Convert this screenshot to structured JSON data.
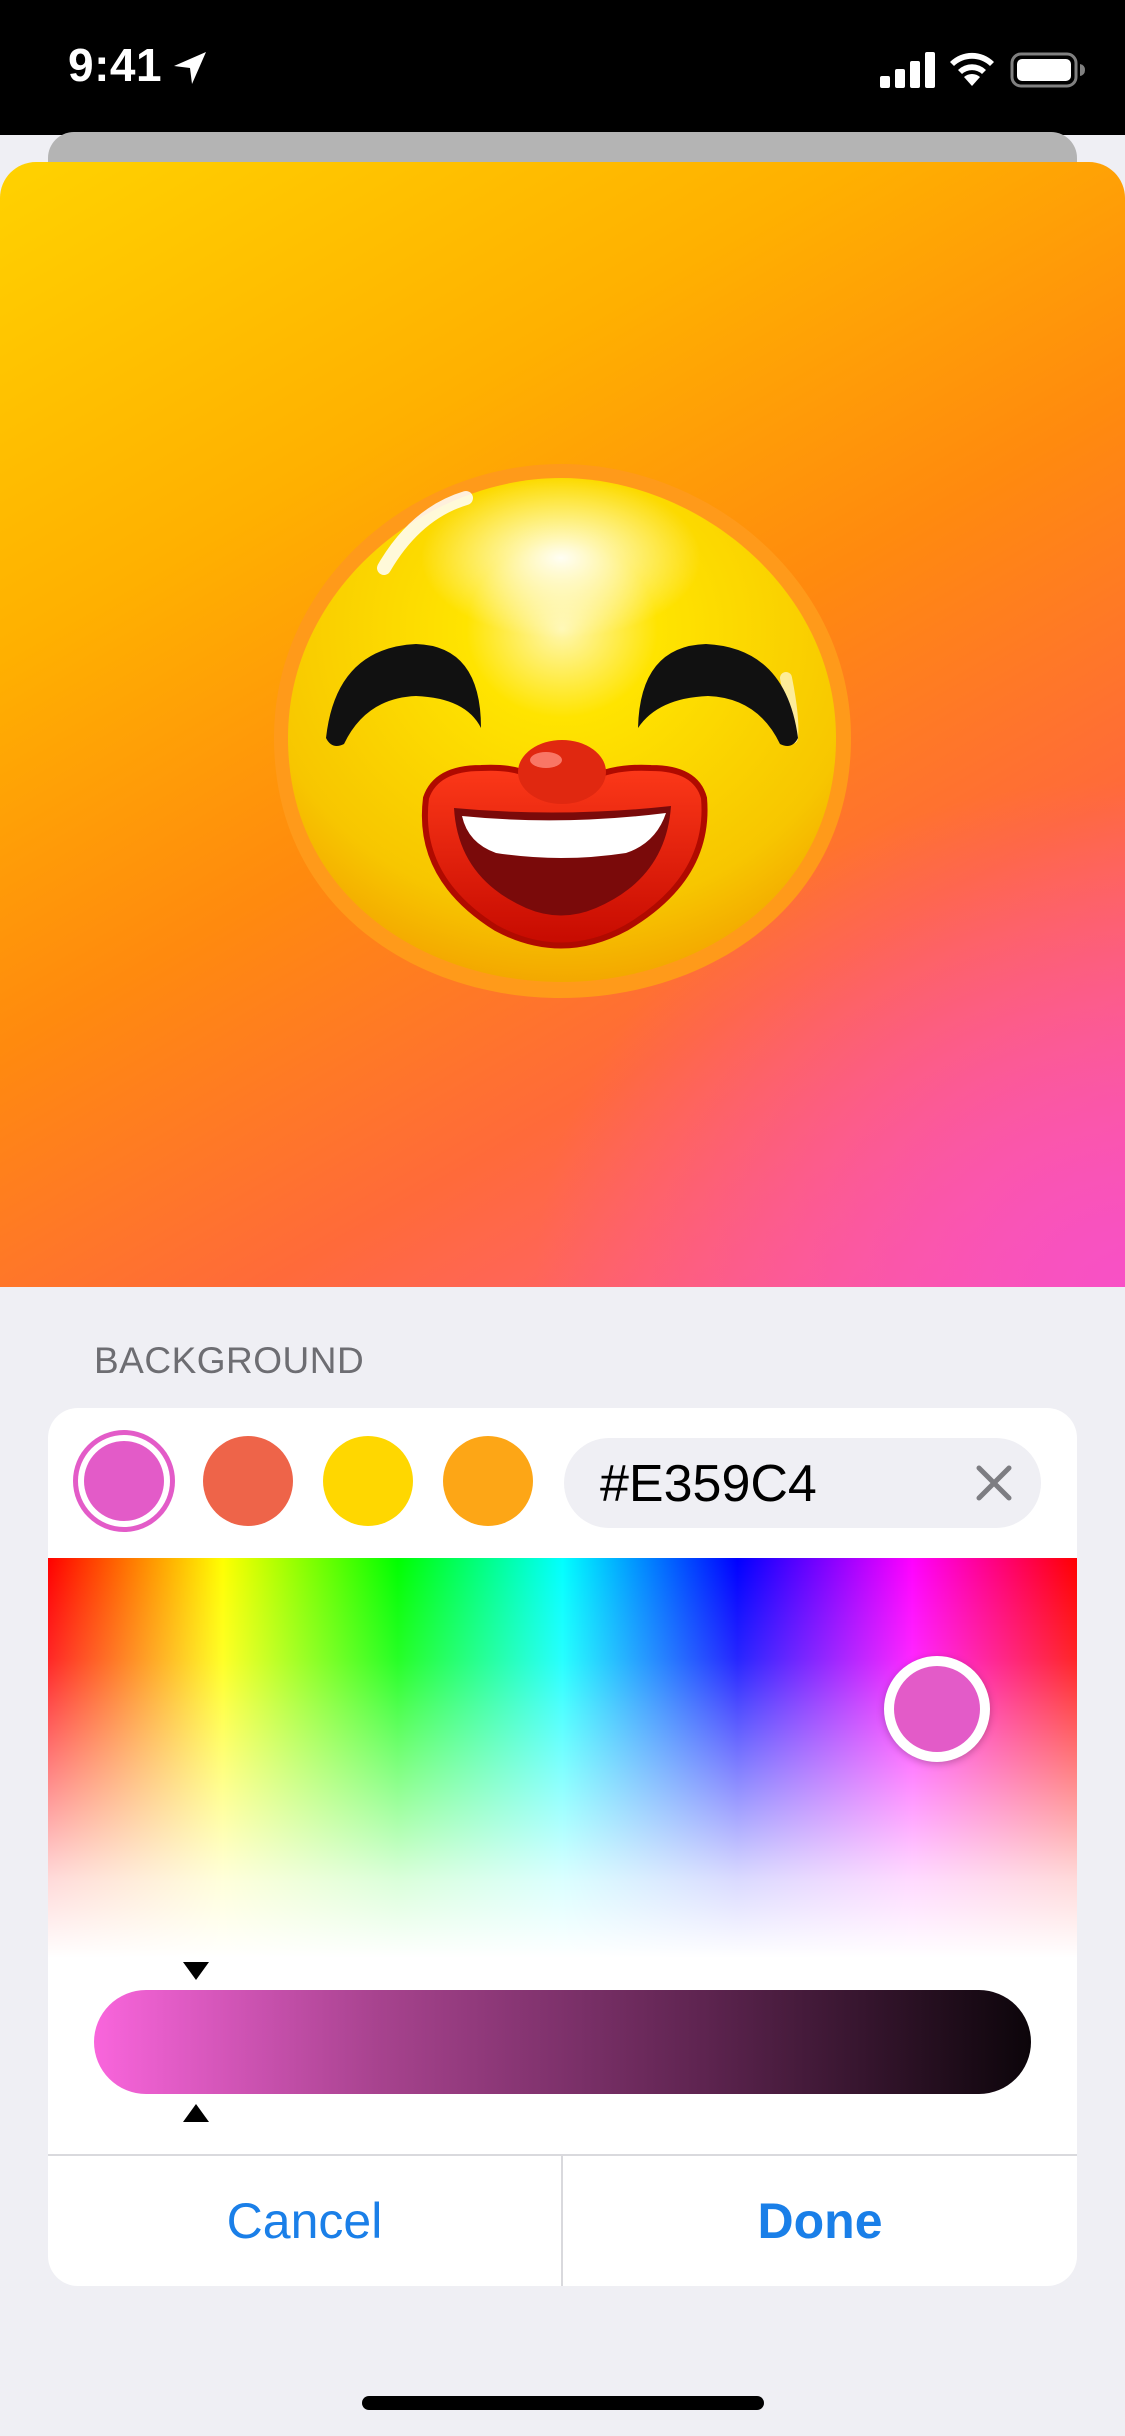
{
  "status_bar": {
    "time": "9:41",
    "icons": [
      "location-arrow-icon",
      "cellular-signal-icon",
      "wifi-icon",
      "battery-icon"
    ]
  },
  "preview": {
    "emoji_icon": "grinning-clown-face-emoji",
    "gradient_colors": [
      "#ffd200",
      "#ffb000",
      "#ff8a0e",
      "#ff6a3a",
      "#f750c8"
    ]
  },
  "background_section": {
    "title": "BACKGROUND"
  },
  "color_picker": {
    "swatches": [
      {
        "color": "#e35bc8",
        "selected": true
      },
      {
        "color": "#ee6449",
        "selected": false
      },
      {
        "color": "#ffd700",
        "selected": false
      },
      {
        "color": "#fda616",
        "selected": false
      }
    ],
    "hex_value": "#E359C4",
    "clear_icon": "close-x-icon",
    "selected_color": "#e35bc8",
    "brightness_level": 0.11
  },
  "actions": {
    "cancel_label": "Cancel",
    "done_label": "Done"
  },
  "colors": {
    "accent": "#1a7fe8",
    "sheet_background": "#efeff4"
  }
}
